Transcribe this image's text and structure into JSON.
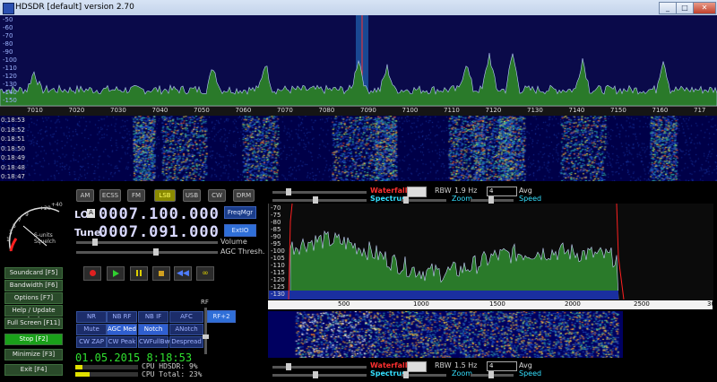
{
  "window": {
    "title": "HDSDR [default]  version 2.70"
  },
  "main_spectrum": {
    "y_labels": [
      "-50",
      "-60",
      "-70",
      "-80",
      "-90",
      "-100",
      "-110",
      "-120",
      "-130",
      "-140",
      "-150"
    ],
    "freq_labels": [
      "7010",
      "7020",
      "7030",
      "7040",
      "7050",
      "7060",
      "7070",
      "7080",
      "7090",
      "7100",
      "7110",
      "7120",
      "7130",
      "7140",
      "7150",
      "7160",
      "717"
    ]
  },
  "waterfall": {
    "times": [
      "0:18:53",
      "0:18:52",
      "0:18:51",
      "0:18:50",
      "0:18:49",
      "0:18:48",
      "0:18:47"
    ]
  },
  "modes": [
    "AM",
    "ECSS",
    "FM",
    "LSB",
    "USB",
    "CW",
    "DRM"
  ],
  "selected_mode": "LSB",
  "lo": {
    "label": "LO",
    "badge": "A",
    "value": "0007.100.000"
  },
  "tune": {
    "label": "Tune",
    "value": "0007.091.000"
  },
  "freqmgr_label": "FreqMgr",
  "extio_label": "ExtIO",
  "volume_label": "Volume",
  "agc_thresh_label": "AGC Thresh.",
  "smeter": {
    "title": "S-units",
    "sub": "Squelch",
    "marks": [
      "+20",
      "+40",
      "9",
      "7",
      "5",
      "3",
      "1"
    ]
  },
  "side_buttons": [
    "Soundcard  [F5]",
    "Bandwidth  [F6]",
    "Options  [F7]",
    "Help / Update  [F1]",
    "Full Screen  [F11]",
    "Stop  [F2]",
    "Minimize  [F3]",
    "Exit  [F4]"
  ],
  "dsp_row1": [
    "NR",
    "NB RF",
    "NB IF",
    "AFC"
  ],
  "dsp_row2": [
    "Mute",
    "AGC Med",
    "Notch",
    "ANotch"
  ],
  "dsp_row3": [
    "CW ZAP",
    "CW Peak",
    "CWFullBw",
    "Despread"
  ],
  "rf_label": "RF",
  "rf_gain": "RF+2",
  "datetime": "01.05.2015  8:18:53",
  "cpu_hdsdr": "CPU HDSDR:   9%",
  "cpu_total": "CPU Total:  23%",
  "top_rf_controls": {
    "waterfall": "Waterfall",
    "spectrum": "Spectrum",
    "rbw_label": "RBW",
    "rbw_value": "1.9 Hz",
    "zoom": "Zoom",
    "avg": "Avg",
    "speed": "Speed",
    "avg_value": "4"
  },
  "bottom_af_controls": {
    "waterfall": "Waterfall",
    "spectrum": "Spectrum",
    "rbw_label": "RBW",
    "rbw_value": "1.5 Hz",
    "zoom": "Zoom",
    "avg": "Avg",
    "speed": "Speed",
    "avg_value": "4"
  },
  "audio_spectrum": {
    "y_labels": [
      "-70",
      "-75",
      "-80",
      "-85",
      "-90",
      "-95",
      "-100",
      "-105",
      "-110",
      "-115",
      "-120",
      "-125",
      "-130"
    ],
    "x_labels": [
      "500",
      "1000",
      "1500",
      "2000",
      "2500",
      "30"
    ]
  },
  "colors": {
    "spectrum_fill": "#2a7a2a",
    "title_bar": "#c3d3ea",
    "accent_red": "#ff3030",
    "accent_cyan": "#35e0ff"
  }
}
